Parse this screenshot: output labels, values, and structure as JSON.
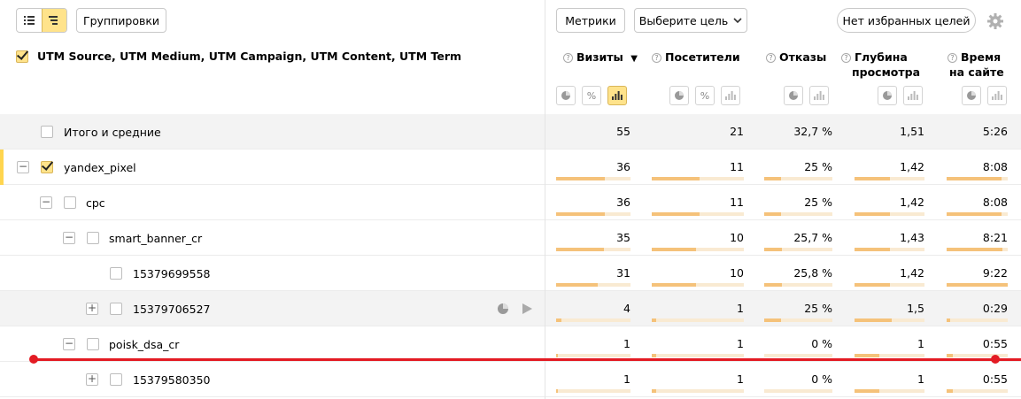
{
  "toolbar": {
    "view_list_icon": "list-icon",
    "view_tree_icon": "tree-icon",
    "group_btn": "Группировки",
    "metrics_btn": "Метрики",
    "goal_select": "Выберите цель",
    "favorites_btn": "Нет избранных целей",
    "settings_icon": "gear-icon"
  },
  "header": {
    "dimensions": "UTM Source, UTM Medium, UTM Campaign, UTM Content, UTM Term",
    "columns": [
      {
        "line1": "Визиты",
        "line2": "",
        "sort": "▼"
      },
      {
        "line1": "Посетители",
        "line2": ""
      },
      {
        "line1": "Отказы",
        "line2": ""
      },
      {
        "line1": "Глубина",
        "line2": "просмотра"
      },
      {
        "line1": "Время",
        "line2": "на сайте"
      }
    ]
  },
  "rows": [
    {
      "label": "Итого и средние",
      "visits": "55",
      "visitors": "21",
      "bounce": "32,7 %",
      "depth": "1,51",
      "time": "5:26"
    },
    {
      "label": "yandex_pixel",
      "visits": "36",
      "visitors": "11",
      "bounce": "25 %",
      "depth": "1,42",
      "time": "8:08",
      "bars": {
        "visits": 0.65,
        "visitors": 0.52,
        "bounce": 0.25,
        "depth": 0.5,
        "time": 0.9
      }
    },
    {
      "label": "cpc",
      "visits": "36",
      "visitors": "11",
      "bounce": "25 %",
      "depth": "1,42",
      "time": "8:08",
      "bars": {
        "visits": 0.65,
        "visitors": 0.52,
        "bounce": 0.25,
        "depth": 0.5,
        "time": 0.9
      }
    },
    {
      "label": "smart_banner_cr",
      "visits": "35",
      "visitors": "10",
      "bounce": "25,7 %",
      "depth": "1,43",
      "time": "8:21",
      "bars": {
        "visits": 0.64,
        "visitors": 0.48,
        "bounce": 0.26,
        "depth": 0.5,
        "time": 0.92
      }
    },
    {
      "label": "15379699558",
      "visits": "31",
      "visitors": "10",
      "bounce": "25,8 %",
      "depth": "1,42",
      "time": "9:22",
      "bars": {
        "visits": 0.56,
        "visitors": 0.48,
        "bounce": 0.26,
        "depth": 0.5,
        "time": 1.0
      }
    },
    {
      "label": "15379706527",
      "visits": "4",
      "visitors": "1",
      "bounce": "25 %",
      "depth": "1,5",
      "time": "0:29",
      "bars": {
        "visits": 0.07,
        "visitors": 0.05,
        "bounce": 0.25,
        "depth": 0.53,
        "time": 0.06
      }
    },
    {
      "label": "poisk_dsa_cr",
      "visits": "1",
      "visitors": "1",
      "bounce": "0 %",
      "depth": "1",
      "time": "0:55",
      "bars": {
        "visits": 0.02,
        "visitors": 0.05,
        "bounce": 0.0,
        "depth": 0.35,
        "time": 0.1
      }
    },
    {
      "label": "15379580350",
      "visits": "1",
      "visitors": "1",
      "bounce": "0 %",
      "depth": "1",
      "time": "0:55",
      "bars": {
        "visits": 0.02,
        "visitors": 0.05,
        "bounce": 0.0,
        "depth": 0.35,
        "time": 0.1
      }
    }
  ],
  "colors": {
    "accent": "#ffe38b",
    "bar": "#f5c27a",
    "annotation_line": "#e31b23"
  }
}
